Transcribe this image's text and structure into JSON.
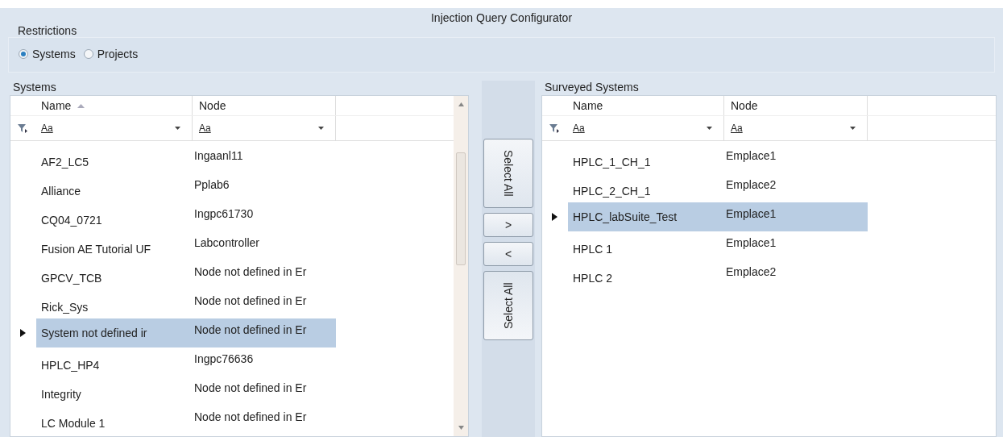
{
  "window": {
    "title": "Injection Query Configurator"
  },
  "restrictions": {
    "title": "Restrictions",
    "options": [
      {
        "label": "Systems",
        "selected": true
      },
      {
        "label": "Projects",
        "selected": false
      }
    ]
  },
  "systems": {
    "title": "Systems",
    "columns": [
      {
        "label": "Name",
        "sorted": true,
        "filter": "Aa"
      },
      {
        "label": "Node",
        "sorted": false,
        "filter": "Aa"
      }
    ],
    "rows": [
      {
        "cells": [
          "AF2_LC5",
          "Ingaanl11"
        ],
        "selected": false
      },
      {
        "cells": [
          "Alliance",
          "Pplab6"
        ],
        "selected": false
      },
      {
        "cells": [
          "CQ04_0721",
          "Ingpc61730"
        ],
        "selected": false
      },
      {
        "cells": [
          "Fusion AE Tutorial UF",
          "Labcontroller"
        ],
        "selected": false
      },
      {
        "cells": [
          "GPCV_TCB",
          "Node not defined in Er"
        ],
        "selected": false
      },
      {
        "cells": [
          "Rick_Sys",
          "Node not defined in Er"
        ],
        "selected": false
      },
      {
        "cells": [
          "System not defined ir",
          "Node not defined in Er"
        ],
        "selected": true
      },
      {
        "cells": [
          "HPLC_HP4",
          "Ingpc76636"
        ],
        "selected": false
      },
      {
        "cells": [
          "Integrity",
          "Node not defined in Er"
        ],
        "selected": false
      },
      {
        "cells": [
          "LC Module 1",
          "Node not defined in Er"
        ],
        "selected": false
      }
    ]
  },
  "transfer_buttons": [
    {
      "label": "Select All",
      "kind": "vertical-down"
    },
    {
      "label": ">",
      "kind": "small"
    },
    {
      "label": "<",
      "kind": "small"
    },
    {
      "label": "Select All",
      "kind": "vertical-up"
    }
  ],
  "surveyed": {
    "title": "Surveyed Systems",
    "columns": [
      {
        "label": "Name",
        "sorted": false,
        "filter": "Aa"
      },
      {
        "label": "Node",
        "sorted": false,
        "filter": "Aa"
      }
    ],
    "rows": [
      {
        "cells": [
          "HPLC_1_CH_1",
          "Emplace1"
        ],
        "selected": false
      },
      {
        "cells": [
          "HPLC_2_CH_1",
          "Emplace2"
        ],
        "selected": false
      },
      {
        "cells": [
          "HPLC_labSuite_Test",
          "Emplace1"
        ],
        "selected": true
      },
      {
        "cells": [
          "HPLC 1",
          "Emplace1"
        ],
        "selected": false
      },
      {
        "cells": [
          "HPLC 2",
          "Emplace2"
        ],
        "selected": false
      }
    ]
  }
}
